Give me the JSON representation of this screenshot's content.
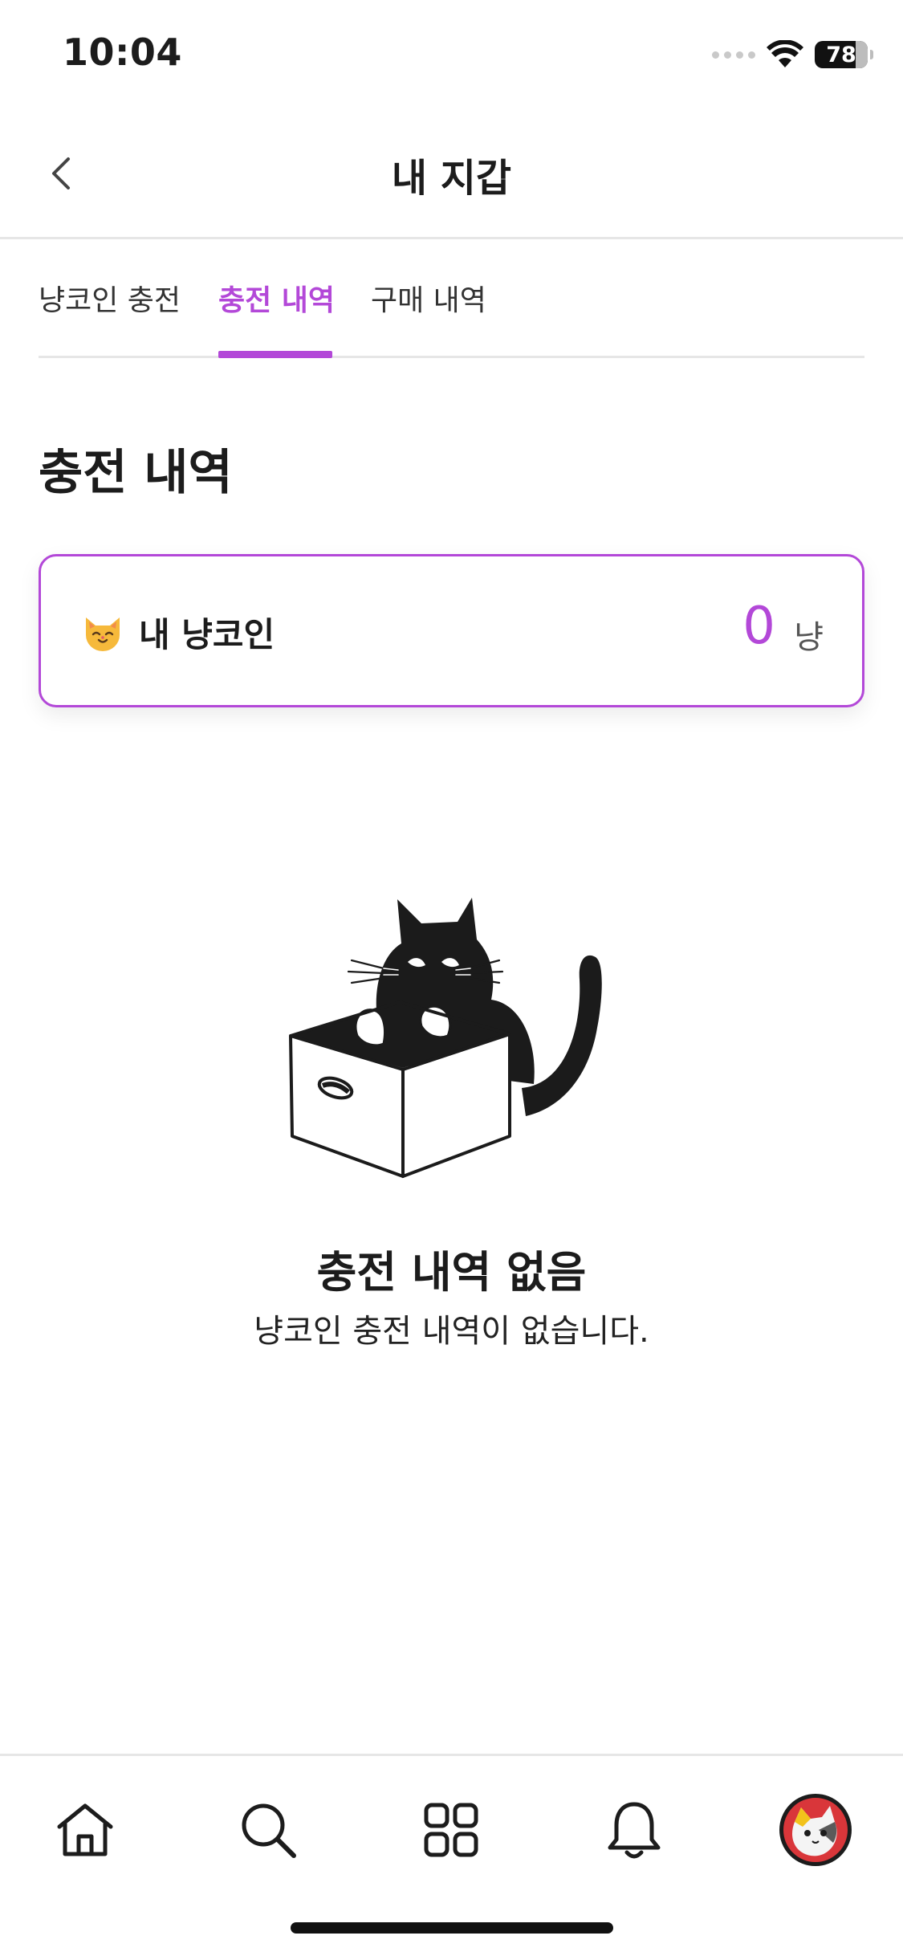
{
  "status_bar": {
    "time": "10:04",
    "battery": "78"
  },
  "header": {
    "title": "내 지갑"
  },
  "tabs": [
    {
      "label": "냥코인 충전",
      "active": false
    },
    {
      "label": "충전 내역",
      "active": true
    },
    {
      "label": "구매 내역",
      "active": false
    }
  ],
  "section": {
    "title": "충전 내역"
  },
  "coin_card": {
    "label": "내 냥코인",
    "value": "0",
    "unit": "냥"
  },
  "empty_state": {
    "title": "충전 내역 없음",
    "description": "냥코인 충전 내역이 없습니다."
  },
  "bottom_nav": [
    {
      "icon": "home-icon"
    },
    {
      "icon": "search-icon"
    },
    {
      "icon": "grid-icon"
    },
    {
      "icon": "bell-icon"
    },
    {
      "icon": "profile-avatar"
    }
  ],
  "colors": {
    "accent": "#b348d8",
    "text": "#1c1c1c",
    "divider": "#e6e6e6"
  }
}
